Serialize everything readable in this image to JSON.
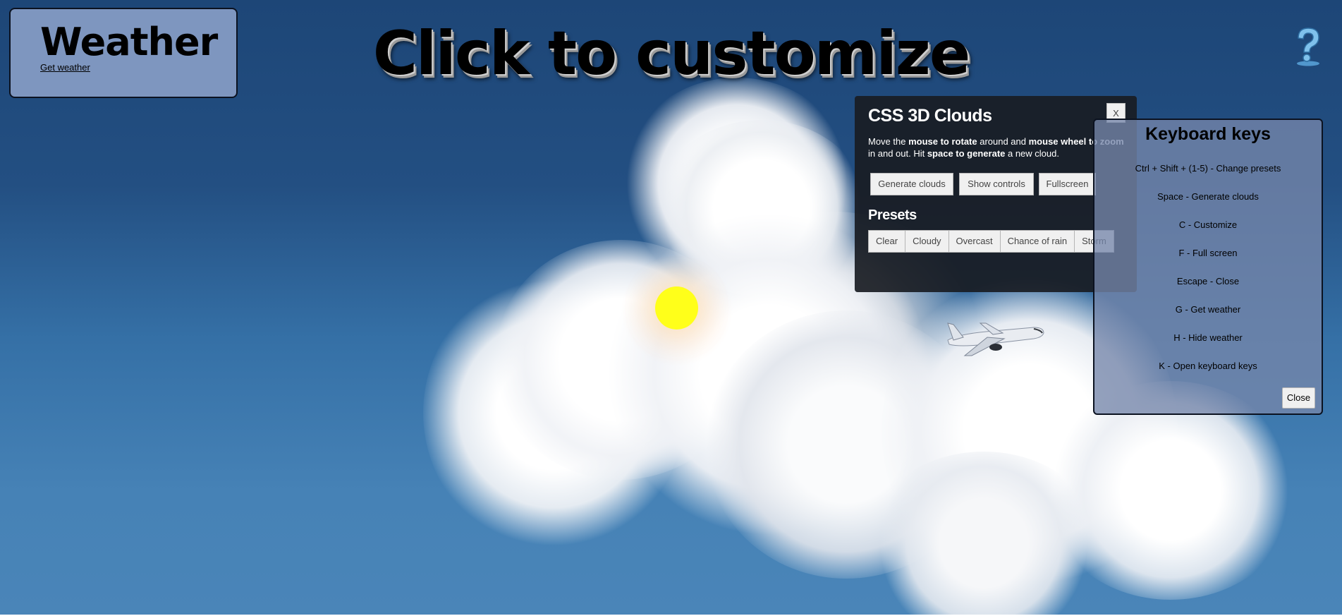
{
  "weather": {
    "title": "Weather",
    "link": "Get weather"
  },
  "headline": "Click to customize",
  "icons": {
    "help": "help-question-icon",
    "airplane": "airplane-icon",
    "sun": "sun-icon"
  },
  "colors": {
    "sun": "#ffff1a",
    "sky_top": "#1d4677",
    "sky_bottom": "#4a85b8",
    "panel": "#191c23"
  },
  "clouds_panel": {
    "title": "CSS 3D Clouds",
    "close": "X",
    "desc": {
      "t1": "Move the ",
      "b1": "mouse to rotate",
      "t2": " around and ",
      "b2": "mouse wheel to zoom",
      "t3": " in and out. Hit ",
      "b3": "space to generate",
      "t4": " a new cloud."
    },
    "buttons": [
      "Generate clouds",
      "Show controls",
      "Fullscreen"
    ],
    "presets_title": "Presets",
    "presets": [
      "Clear",
      "Cloudy",
      "Overcast",
      "Chance of rain",
      "Storm"
    ]
  },
  "keys_panel": {
    "title": "Keyboard keys",
    "items": [
      "Ctrl + Shift + (1-5) - Change presets",
      "Space - Generate clouds",
      "C - Customize",
      "F - Full screen",
      "Escape - Close",
      "G - Get weather",
      "H - Hide weather",
      "K - Open keyboard keys"
    ],
    "close": "Close"
  }
}
